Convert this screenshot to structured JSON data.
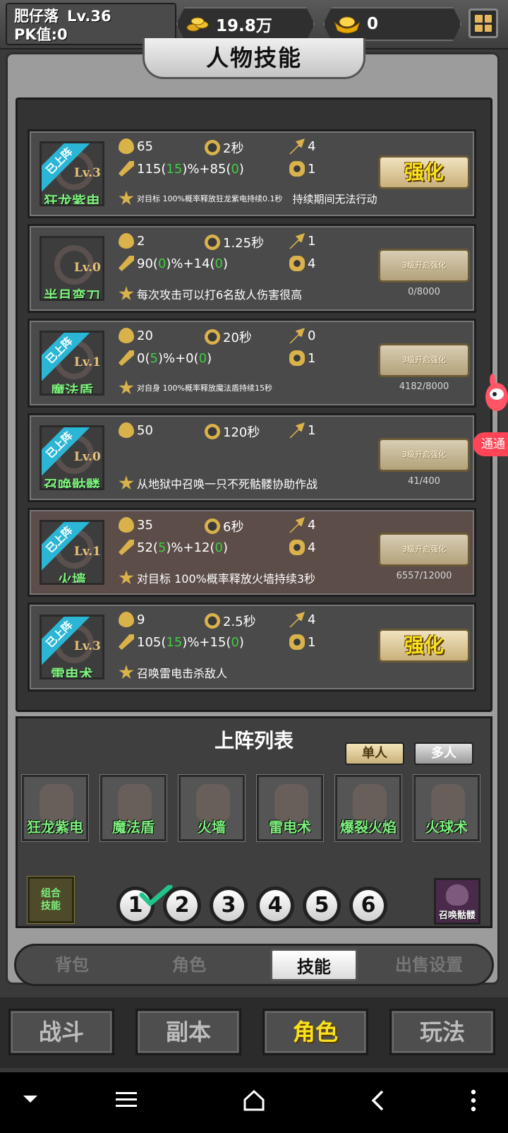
{
  "header": {
    "player_name": "肥仔落",
    "level": "Lv.36",
    "pk": "PK值:0",
    "gold": "19.8万",
    "ingot": "0",
    "gold_icon": "gold-coins-icon",
    "ingot_icon": "gold-ingot-icon",
    "menu_icon": "grid-menu-icon"
  },
  "panel_title": "人物技能",
  "skills": [
    {
      "name": "狂龙紫电",
      "level": "Lv.3",
      "equipped_badge": "已上阵",
      "mp": "65",
      "cooldown": "2秒",
      "range": "4",
      "damage_pre": "115(",
      "damage_bonus": "15",
      "damage_mid": ")%+85(",
      "damage_flat": "0",
      "damage_post": ")",
      "targets": "1",
      "desc": "对目标 100%概率释放狂龙紫电持续0.1秒",
      "desc_extra": "持续期间无法行动",
      "button": "强化",
      "progress": ""
    },
    {
      "name": "半月弯刀",
      "level": "Lv.0",
      "equipped_badge": "",
      "mp": "2",
      "cooldown": "1.25秒",
      "range": "1",
      "damage_pre": "90(",
      "damage_bonus": "0",
      "damage_mid": ")%+14(",
      "damage_flat": "0",
      "damage_post": ")",
      "targets": "4",
      "desc": "每次攻击可以打6名敌人伤害很高",
      "desc_extra": "",
      "button": "3级开启强化",
      "progress": "0/8000"
    },
    {
      "name": "魔法盾",
      "level": "Lv.1",
      "equipped_badge": "已上阵",
      "mp": "20",
      "cooldown": "20秒",
      "range": "0",
      "damage_pre": "0(",
      "damage_bonus": "5",
      "damage_mid": ")%+0(",
      "damage_flat": "0",
      "damage_post": ")",
      "targets": "1",
      "desc": "对自身 100%概率释放魔法盾持续15秒",
      "desc_extra": "",
      "button": "3级开启强化",
      "progress": "4182/8000"
    },
    {
      "name": "召唤骷髅",
      "level": "Lv.0",
      "equipped_badge": "已上阵",
      "mp": "50",
      "cooldown": "120秒",
      "range": "1",
      "damage_pre": "",
      "damage_bonus": "",
      "damage_mid": "",
      "damage_flat": "",
      "damage_post": "",
      "targets": "",
      "desc": "从地狱中召唤一只不死骷髅协助作战",
      "desc_extra": "",
      "button": "3级开启强化",
      "progress": "41/400"
    },
    {
      "name": "火墙",
      "level": "Lv.1",
      "equipped_badge": "已上阵",
      "mp": "35",
      "cooldown": "6秒",
      "range": "4",
      "damage_pre": "52(",
      "damage_bonus": "5",
      "damage_mid": ")%+12(",
      "damage_flat": "0",
      "damage_post": ")",
      "targets": "4",
      "desc": "对目标 100%概率释放火墙持续3秒",
      "desc_extra": "",
      "button": "3级开启强化",
      "progress": "6557/12000"
    },
    {
      "name": "雷电术",
      "level": "Lv.3",
      "equipped_badge": "已上阵",
      "mp": "9",
      "cooldown": "2.5秒",
      "range": "4",
      "damage_pre": "105(",
      "damage_bonus": "15",
      "damage_mid": ")%+15(",
      "damage_flat": "0",
      "damage_post": ")",
      "targets": "1",
      "desc": "召唤雷电击杀敌人",
      "desc_extra": "",
      "button": "强化",
      "progress": ""
    }
  ],
  "lineup": {
    "title": "上阵列表",
    "mode_single": "单人",
    "mode_multi": "多人",
    "slots": [
      "狂龙紫电",
      "魔法盾",
      "火墙",
      "雷电术",
      "爆裂火焰",
      "火球术"
    ],
    "combo_label": "组合技能",
    "presets": [
      "1",
      "2",
      "3",
      "4",
      "5",
      "6"
    ],
    "selected_preset": "1",
    "summon_label": "召唤骷髅"
  },
  "subtabs": [
    "背包",
    "角色",
    "技能",
    "出售设置"
  ],
  "active_subtab": "技能",
  "maintabs": [
    "战斗",
    "副本",
    "角色",
    "玩法"
  ],
  "active_maintab": "角色",
  "float_ad": "通通",
  "colors": {
    "bonus_green": "#3fcf3f",
    "name_green": "#7ef07e",
    "ribbon_blue": "#2bb6d6",
    "accent_yellow": "#f8e11e"
  }
}
